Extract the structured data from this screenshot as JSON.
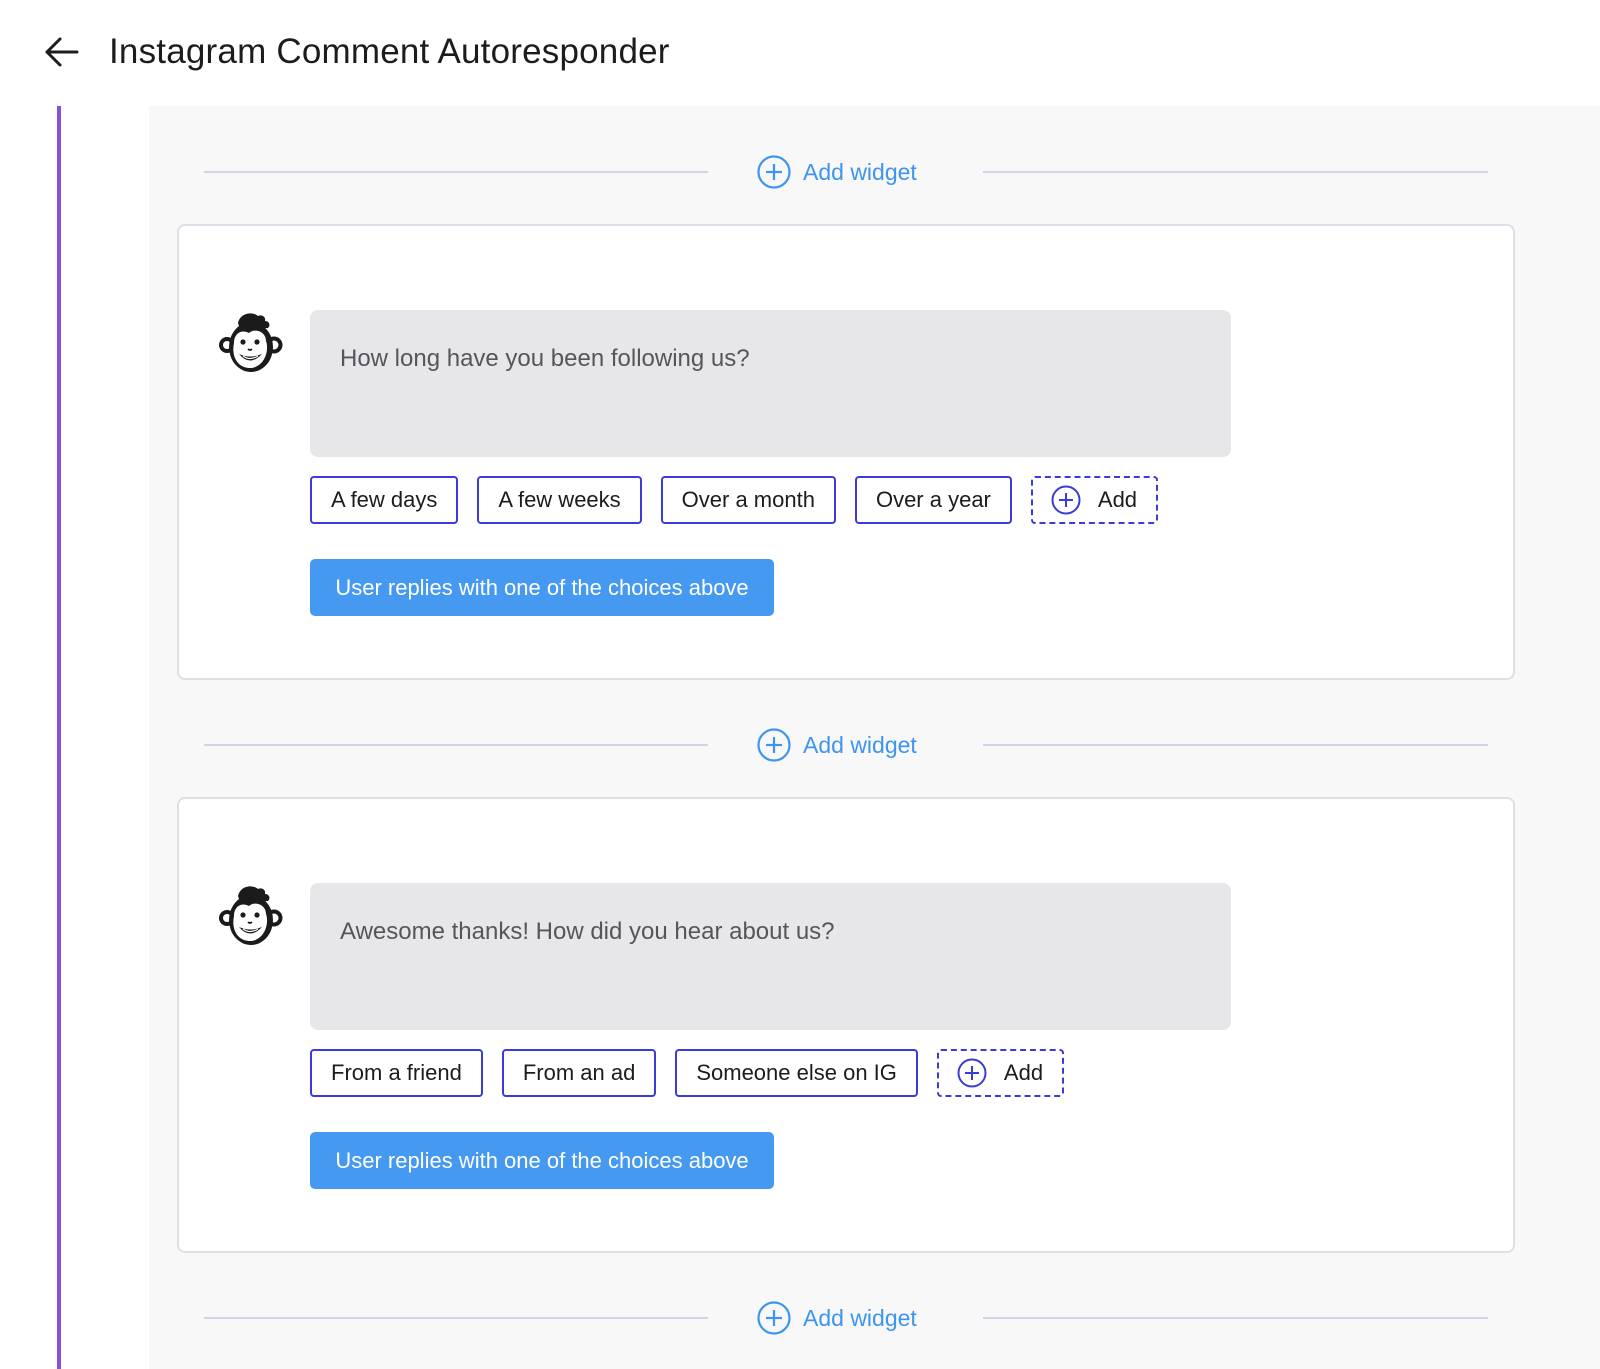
{
  "header": {
    "title": "Instagram Comment Autoresponder",
    "back_icon": "arrow-left-icon"
  },
  "add_widget": {
    "label": "Add widget",
    "icon": "plus-circle-icon"
  },
  "cards": [
    {
      "avatar_icon": "monkey-mascot-icon",
      "message": "How long have you been following us?",
      "choices": [
        "A few days",
        "A few weeks",
        "Over a month",
        "Over a year"
      ],
      "add_choice_label": "Add",
      "reply_trigger": "User replies with one of the choices above"
    },
    {
      "avatar_icon": "monkey-mascot-icon",
      "message": "Awesome thanks! How did you hear about us?",
      "choices": [
        "From a friend",
        "From an ad",
        "Someone else on IG"
      ],
      "add_choice_label": "Add",
      "reply_trigger": "User replies with one of the choices above"
    }
  ],
  "colors": {
    "accent": "#4599f0",
    "chip_border": "#3b3bd9",
    "rail": "#8a4fdd",
    "bubble_bg": "#e7e7ea"
  }
}
